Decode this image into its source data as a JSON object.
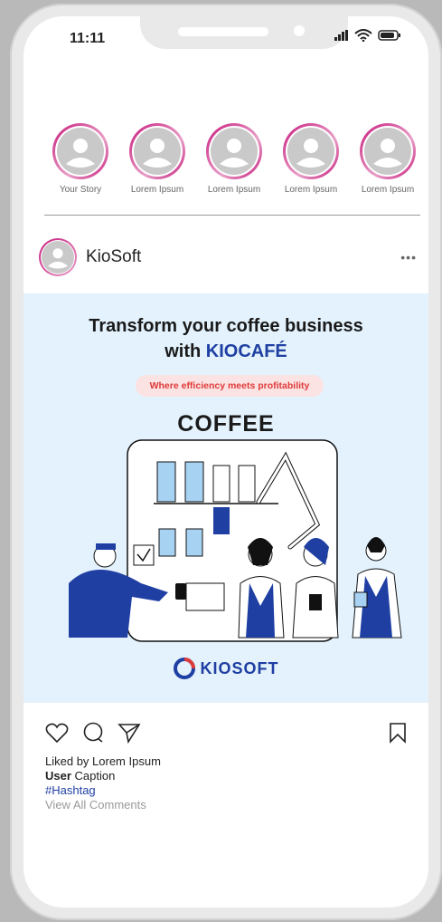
{
  "status_bar": {
    "time": "11:11"
  },
  "stories": [
    {
      "label": "Your Story"
    },
    {
      "label": "Lorem Ipsum"
    },
    {
      "label": "Lorem Ipsum"
    },
    {
      "label": "Lorem Ipsum"
    },
    {
      "label": "Lorem Ipsum"
    }
  ],
  "post": {
    "username": "KioSoft",
    "more": "•••",
    "image": {
      "headline_line1": "Transform your coffee business",
      "headline_prefix": "with ",
      "headline_brand": "KIOCAFÉ",
      "tagline": "Where efficiency meets profitability",
      "coffee_label": "COFFEE",
      "logo_text": "KIOSOFT"
    },
    "likes": "Liked by Lorem Ipsum",
    "caption_user": "User",
    "caption_text": " Caption",
    "hashtag": "#Hashtag",
    "view_comments": "View All Comments"
  },
  "icons": {
    "like": "heart-icon",
    "comment": "comment-icon",
    "share": "send-icon",
    "save": "bookmark-icon"
  },
  "colors": {
    "brand_blue": "#1f3fa3",
    "story_ring": "#c71a7c",
    "tagline_red": "#e03a3a",
    "image_bg": "#e3f2fc"
  }
}
